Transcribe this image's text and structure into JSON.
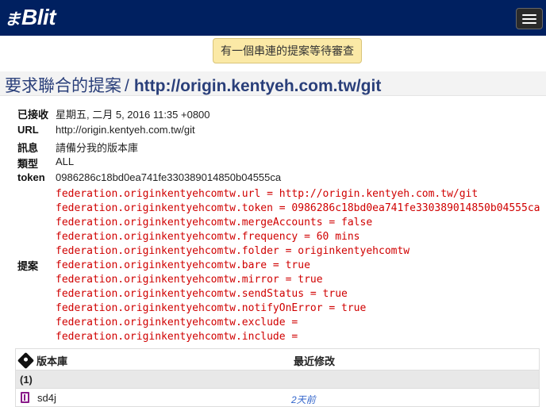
{
  "navbar": {
    "brand_mark": "ま",
    "brand_text": "Blit",
    "menu_icon": "hamburger-icon"
  },
  "notice": {
    "text": "有一個串連的提案等待審查"
  },
  "header": {
    "title_prefix": "要求聯合的提案",
    "separator": "/",
    "url": "http://origin.kentyeh.com.tw/git"
  },
  "details": {
    "received_label": "已接收",
    "received_value": "星期五, 二月 5, 2016 11:35 +0800",
    "url_label": "URL",
    "url_value": "http://origin.kentyeh.com.tw/git",
    "message_label": "訊息",
    "message_value": "請備分我的版本庫",
    "type_label": "類型",
    "type_value": "ALL",
    "token_label": "token",
    "token_value": "0986286c18bd0ea741fe330389014850b04555ca",
    "proposal_label": "提案",
    "proposal_lines": [
      "federation.originkentyehcomtw.url = http://origin.kentyeh.com.tw/git",
      "federation.originkentyehcomtw.token = 0986286c18bd0ea741fe330389014850b04555ca",
      "federation.originkentyehcomtw.mergeAccounts = false",
      "federation.originkentyehcomtw.frequency = 60 mins",
      "federation.originkentyehcomtw.folder = originkentyehcomtw",
      "federation.originkentyehcomtw.bare = true",
      "federation.originkentyehcomtw.mirror = true",
      "federation.originkentyehcomtw.sendStatus = true",
      "federation.originkentyehcomtw.notifyOnError = true",
      "federation.originkentyehcomtw.exclude =",
      "federation.originkentyehcomtw.include ="
    ]
  },
  "repo_table": {
    "col_repo": "版本庫",
    "col_modified": "最近修改",
    "group_label": "(1)",
    "rows": [
      {
        "name": "sd4j",
        "modified": "2天前"
      }
    ]
  }
}
